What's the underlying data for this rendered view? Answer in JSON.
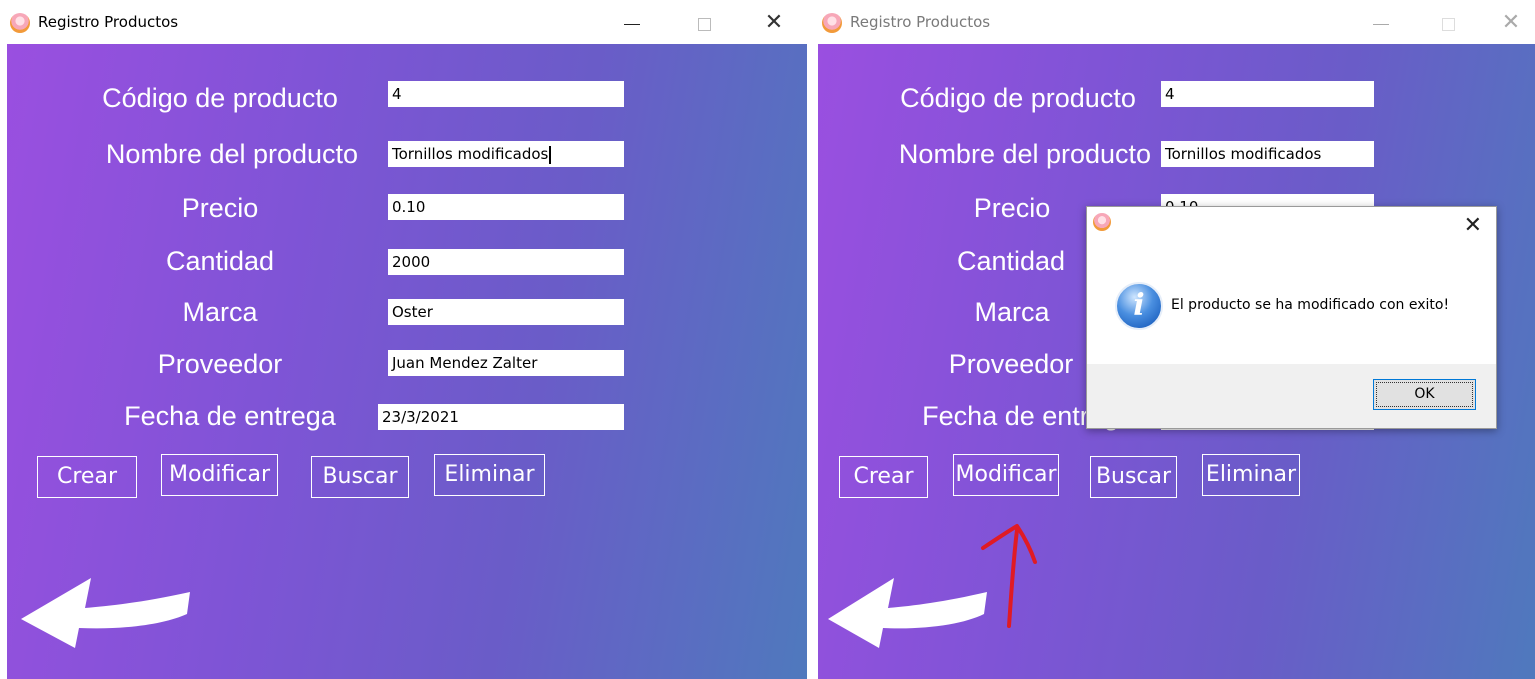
{
  "window_title": "Registro Productos",
  "labels": {
    "codigo": "Código de producto",
    "nombre": "Nombre del producto",
    "precio": "Precio",
    "cantidad": "Cantidad",
    "marca": "Marca",
    "proveedor": "Proveedor",
    "fecha": "Fecha  de entrega"
  },
  "fields": {
    "codigo": "4",
    "nombre": "Tornillos modificados",
    "precio": "0.10",
    "cantidad": "2000",
    "marca": "Oster",
    "proveedor": "Juan Mendez Zalter",
    "fecha": "23/3/2021"
  },
  "buttons": {
    "crear": "Crear",
    "modificar": "Modificar",
    "buscar": "Buscar",
    "eliminar": "Eliminar"
  },
  "dialog": {
    "message": "El producto se ha modificado con exito!",
    "ok": "OK"
  },
  "icons": {
    "app": "app-logo-icon",
    "back": "back-arrow-icon",
    "info": "information-icon",
    "close": "close-icon"
  },
  "colors": {
    "gradient_start": "#9a4fe0",
    "gradient_end": "#4f79bd",
    "annotation": "#e01b24"
  }
}
